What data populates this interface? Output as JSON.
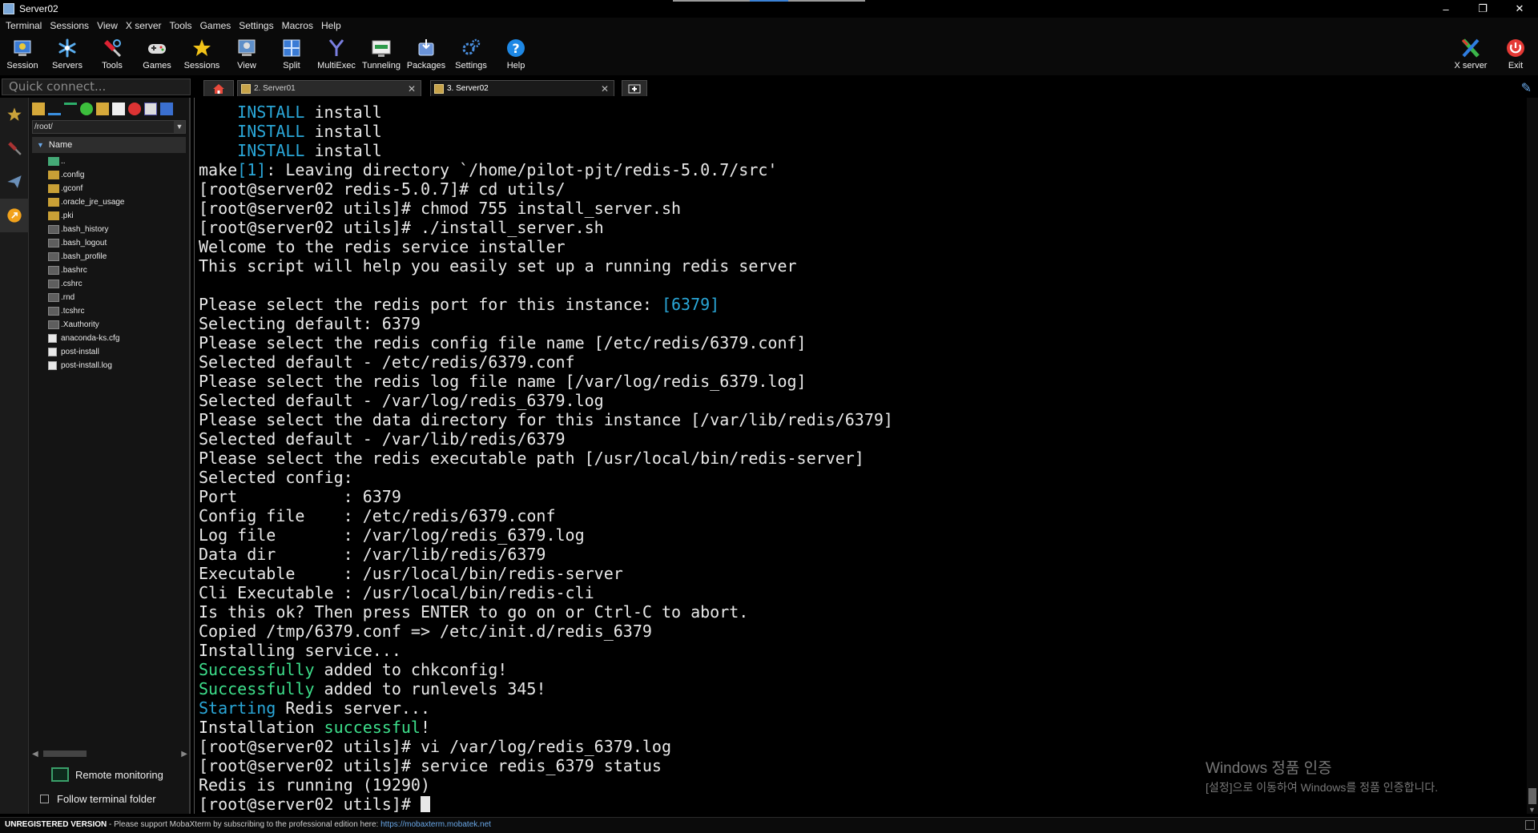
{
  "window": {
    "title": "Server02",
    "minimize": "–",
    "maximize": "❐",
    "close": "✕"
  },
  "menu": [
    "Terminal",
    "Sessions",
    "View",
    "X server",
    "Tools",
    "Games",
    "Settings",
    "Macros",
    "Help"
  ],
  "toolbar": {
    "left": [
      {
        "label": "Session",
        "icon": "session-icon"
      },
      {
        "label": "Servers",
        "icon": "servers-icon"
      },
      {
        "label": "Tools",
        "icon": "tools-icon"
      },
      {
        "label": "Games",
        "icon": "games-icon"
      },
      {
        "label": "Sessions",
        "icon": "star-icon"
      },
      {
        "label": "View",
        "icon": "view-icon"
      },
      {
        "label": "Split",
        "icon": "split-icon"
      },
      {
        "label": "MultiExec",
        "icon": "multiexec-icon"
      },
      {
        "label": "Tunneling",
        "icon": "tunneling-icon"
      },
      {
        "label": "Packages",
        "icon": "packages-icon"
      },
      {
        "label": "Settings",
        "icon": "gear-icon"
      },
      {
        "label": "Help",
        "icon": "help-icon"
      }
    ],
    "right": [
      {
        "label": "X server",
        "icon": "x-server-icon"
      },
      {
        "label": "Exit",
        "icon": "power-icon"
      }
    ]
  },
  "quick_connect": {
    "placeholder": "Quick connect..."
  },
  "tabs": [
    {
      "label": "2. Server01",
      "close": "✕",
      "active": false
    },
    {
      "label": "3. Server02",
      "close": "✕",
      "active": true
    }
  ],
  "file_browser": {
    "path": "/root/",
    "column_header": "Name",
    "items": [
      {
        "name": "..",
        "type": "parent"
      },
      {
        "name": ".config",
        "type": "folder"
      },
      {
        "name": ".gconf",
        "type": "folder"
      },
      {
        "name": ".oracle_jre_usage",
        "type": "folder"
      },
      {
        "name": ".pki",
        "type": "folder"
      },
      {
        "name": ".bash_history",
        "type": "file"
      },
      {
        "name": ".bash_logout",
        "type": "file"
      },
      {
        "name": ".bash_profile",
        "type": "file"
      },
      {
        "name": ".bashrc",
        "type": "file"
      },
      {
        "name": ".cshrc",
        "type": "file"
      },
      {
        "name": ".rnd",
        "type": "file"
      },
      {
        "name": ".tcshrc",
        "type": "file"
      },
      {
        "name": ".Xauthority",
        "type": "file"
      },
      {
        "name": "anaconda-ks.cfg",
        "type": "doc"
      },
      {
        "name": "post-install",
        "type": "doc"
      },
      {
        "name": "post-install.log",
        "type": "doc"
      }
    ],
    "remote_monitoring": "Remote monitoring",
    "follow_terminal_folder": "Follow terminal folder"
  },
  "terminal": {
    "lines": [
      [
        {
          "t": "    "
        },
        {
          "t": "INSTALL",
          "c": "blue"
        },
        {
          "t": " install"
        }
      ],
      [
        {
          "t": "    "
        },
        {
          "t": "INSTALL",
          "c": "blue"
        },
        {
          "t": " install"
        }
      ],
      [
        {
          "t": "    "
        },
        {
          "t": "INSTALL",
          "c": "blue"
        },
        {
          "t": " install"
        }
      ],
      [
        {
          "t": "make"
        },
        {
          "t": "[1]",
          "c": "blue"
        },
        {
          "t": ": Leaving directory `/home/pilot-pjt/redis-5.0.7/src'"
        }
      ],
      [
        {
          "t": "[root@server02 redis-5.0.7]# cd utils/"
        }
      ],
      [
        {
          "t": "[root@server02 utils]# chmod 755 install_server.sh"
        }
      ],
      [
        {
          "t": "[root@server02 utils]# ./install_server.sh"
        }
      ],
      [
        {
          "t": "Welcome to the redis service installer"
        }
      ],
      [
        {
          "t": "This script will help you easily set up a running redis server"
        }
      ],
      [
        {
          "t": ""
        }
      ],
      [
        {
          "t": "Please select the redis port for this instance: "
        },
        {
          "t": "[6379]",
          "c": "blue"
        }
      ],
      [
        {
          "t": "Selecting default: 6379"
        }
      ],
      [
        {
          "t": "Please select the redis config file name [/etc/redis/6379.conf]"
        }
      ],
      [
        {
          "t": "Selected default - /etc/redis/6379.conf"
        }
      ],
      [
        {
          "t": "Please select the redis log file name [/var/log/redis_6379.log]"
        }
      ],
      [
        {
          "t": "Selected default - /var/log/redis_6379.log"
        }
      ],
      [
        {
          "t": "Please select the data directory for this instance [/var/lib/redis/6379]"
        }
      ],
      [
        {
          "t": "Selected default - /var/lib/redis/6379"
        }
      ],
      [
        {
          "t": "Please select the redis executable path [/usr/local/bin/redis-server]"
        }
      ],
      [
        {
          "t": "Selected config:"
        }
      ],
      [
        {
          "t": "Port           : 6379"
        }
      ],
      [
        {
          "t": "Config file    : /etc/redis/6379.conf"
        }
      ],
      [
        {
          "t": "Log file       : /var/log/redis_6379.log"
        }
      ],
      [
        {
          "t": "Data dir       : /var/lib/redis/6379"
        }
      ],
      [
        {
          "t": "Executable     : /usr/local/bin/redis-server"
        }
      ],
      [
        {
          "t": "Cli Executable : /usr/local/bin/redis-cli"
        }
      ],
      [
        {
          "t": "Is this ok? Then press ENTER to go on or Ctrl-C to abort."
        }
      ],
      [
        {
          "t": "Copied /tmp/6379.conf => /etc/init.d/redis_6379"
        }
      ],
      [
        {
          "t": "Installing service..."
        }
      ],
      [
        {
          "t": "Successfully",
          "c": "green"
        },
        {
          "t": " added to chkconfig!"
        }
      ],
      [
        {
          "t": "Successfully",
          "c": "green"
        },
        {
          "t": " added to runlevels 345!"
        }
      ],
      [
        {
          "t": "Starting",
          "c": "blue"
        },
        {
          "t": " Redis server..."
        }
      ],
      [
        {
          "t": "Installation "
        },
        {
          "t": "successful",
          "c": "green"
        },
        {
          "t": "!"
        }
      ],
      [
        {
          "t": "[root@server02 utils]# vi /var/log/redis_6379.log"
        }
      ],
      [
        {
          "t": "[root@server02 utils]# service redis_6379 status"
        }
      ],
      [
        {
          "t": "Redis is running (19290)"
        }
      ],
      [
        {
          "t": "[root@server02 utils]# "
        },
        {
          "t": "",
          "c": "cursor"
        }
      ]
    ]
  },
  "watermark": {
    "line1": "Windows 정품 인증",
    "line2": "[설정]으로 이동하여 Windows를 정품 인증합니다."
  },
  "status_bar": {
    "unregistered": "UNREGISTERED VERSION",
    "message": "  -  Please support MobaXterm by subscribing to the professional edition here:  ",
    "link": "https://mobaxterm.mobatek.net"
  },
  "colors": {
    "blue": "#2aa7d8",
    "green": "#3ddf8b",
    "terminal_bg": "#000000",
    "terminal_fg": "#e8e8e8"
  }
}
